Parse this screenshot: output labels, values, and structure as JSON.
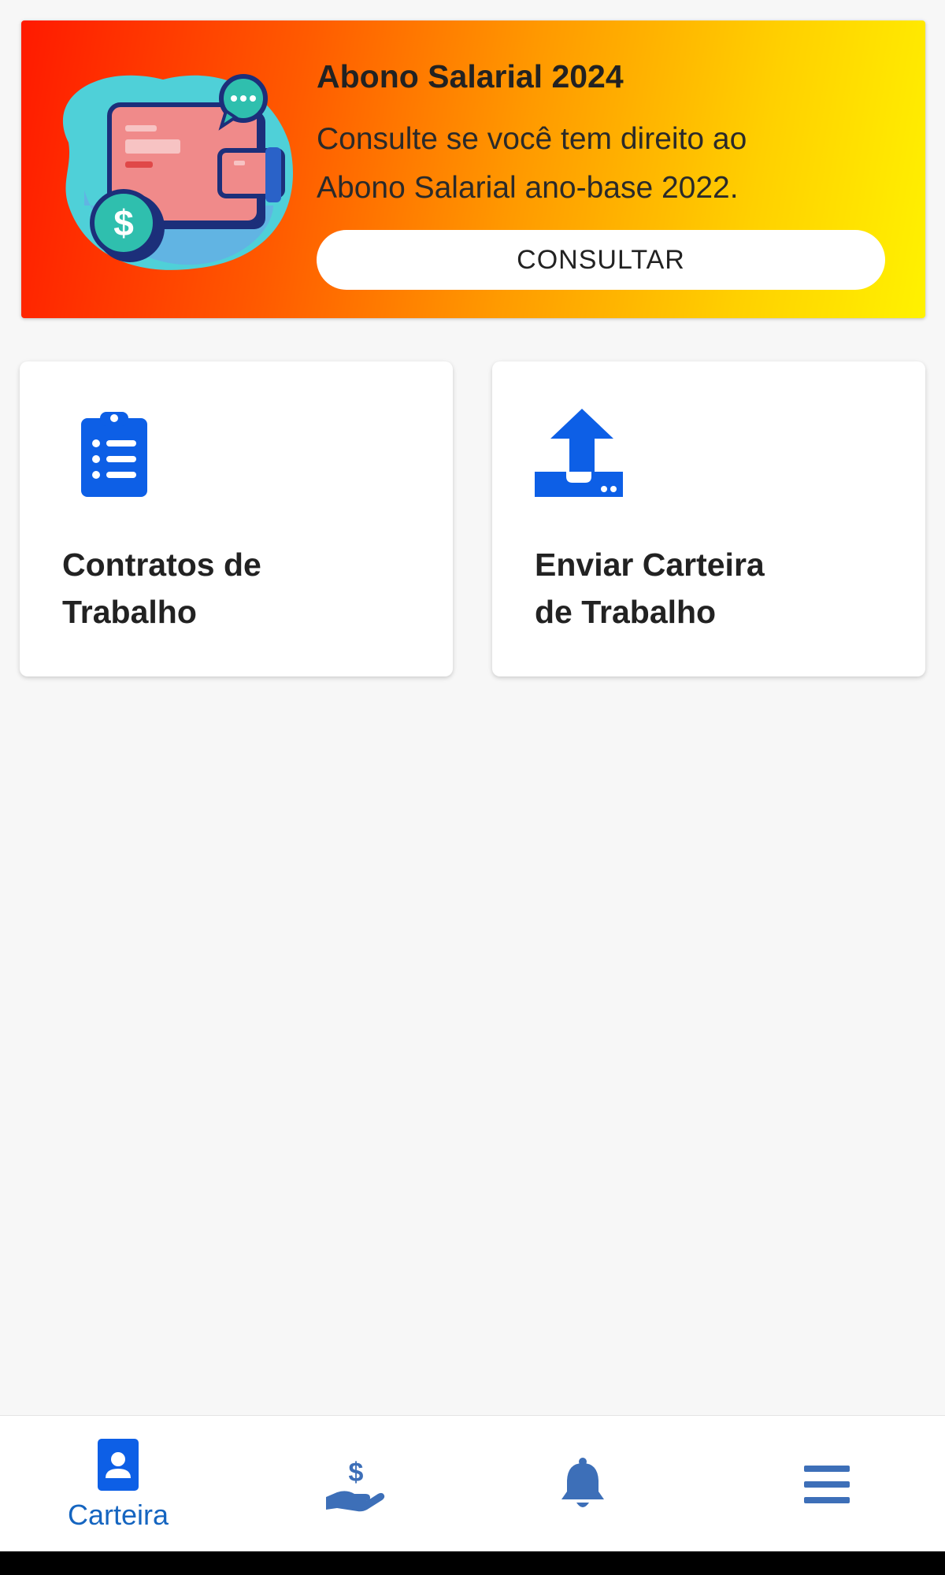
{
  "banner": {
    "title": "Abono Salarial 2024",
    "text": "Consulte se você tem direito ao\nAbono Salarial ano-base 2022.",
    "button_label": "CONSULTAR",
    "gradient": [
      "#ff1a00",
      "#fff200"
    ]
  },
  "cards": [
    {
      "label": "Contratos de\nTrabalho",
      "icon": "clipboard-list-icon"
    },
    {
      "label": "Enviar Carteira\nde Trabalho",
      "icon": "upload-tray-icon"
    }
  ],
  "bottom_nav": {
    "items": [
      {
        "label": "Carteira",
        "icon": "id-card-icon",
        "active": true
      },
      {
        "label": "",
        "icon": "hand-dollar-icon",
        "active": false
      },
      {
        "label": "",
        "icon": "bell-icon",
        "active": false
      },
      {
        "label": "",
        "icon": "menu-icon",
        "active": false
      }
    ]
  },
  "colors": {
    "accent": "#1565c0",
    "icon_blue": "#0d5fe6",
    "nav_icon": "#3d6fb8",
    "background": "#f7f7f7"
  }
}
